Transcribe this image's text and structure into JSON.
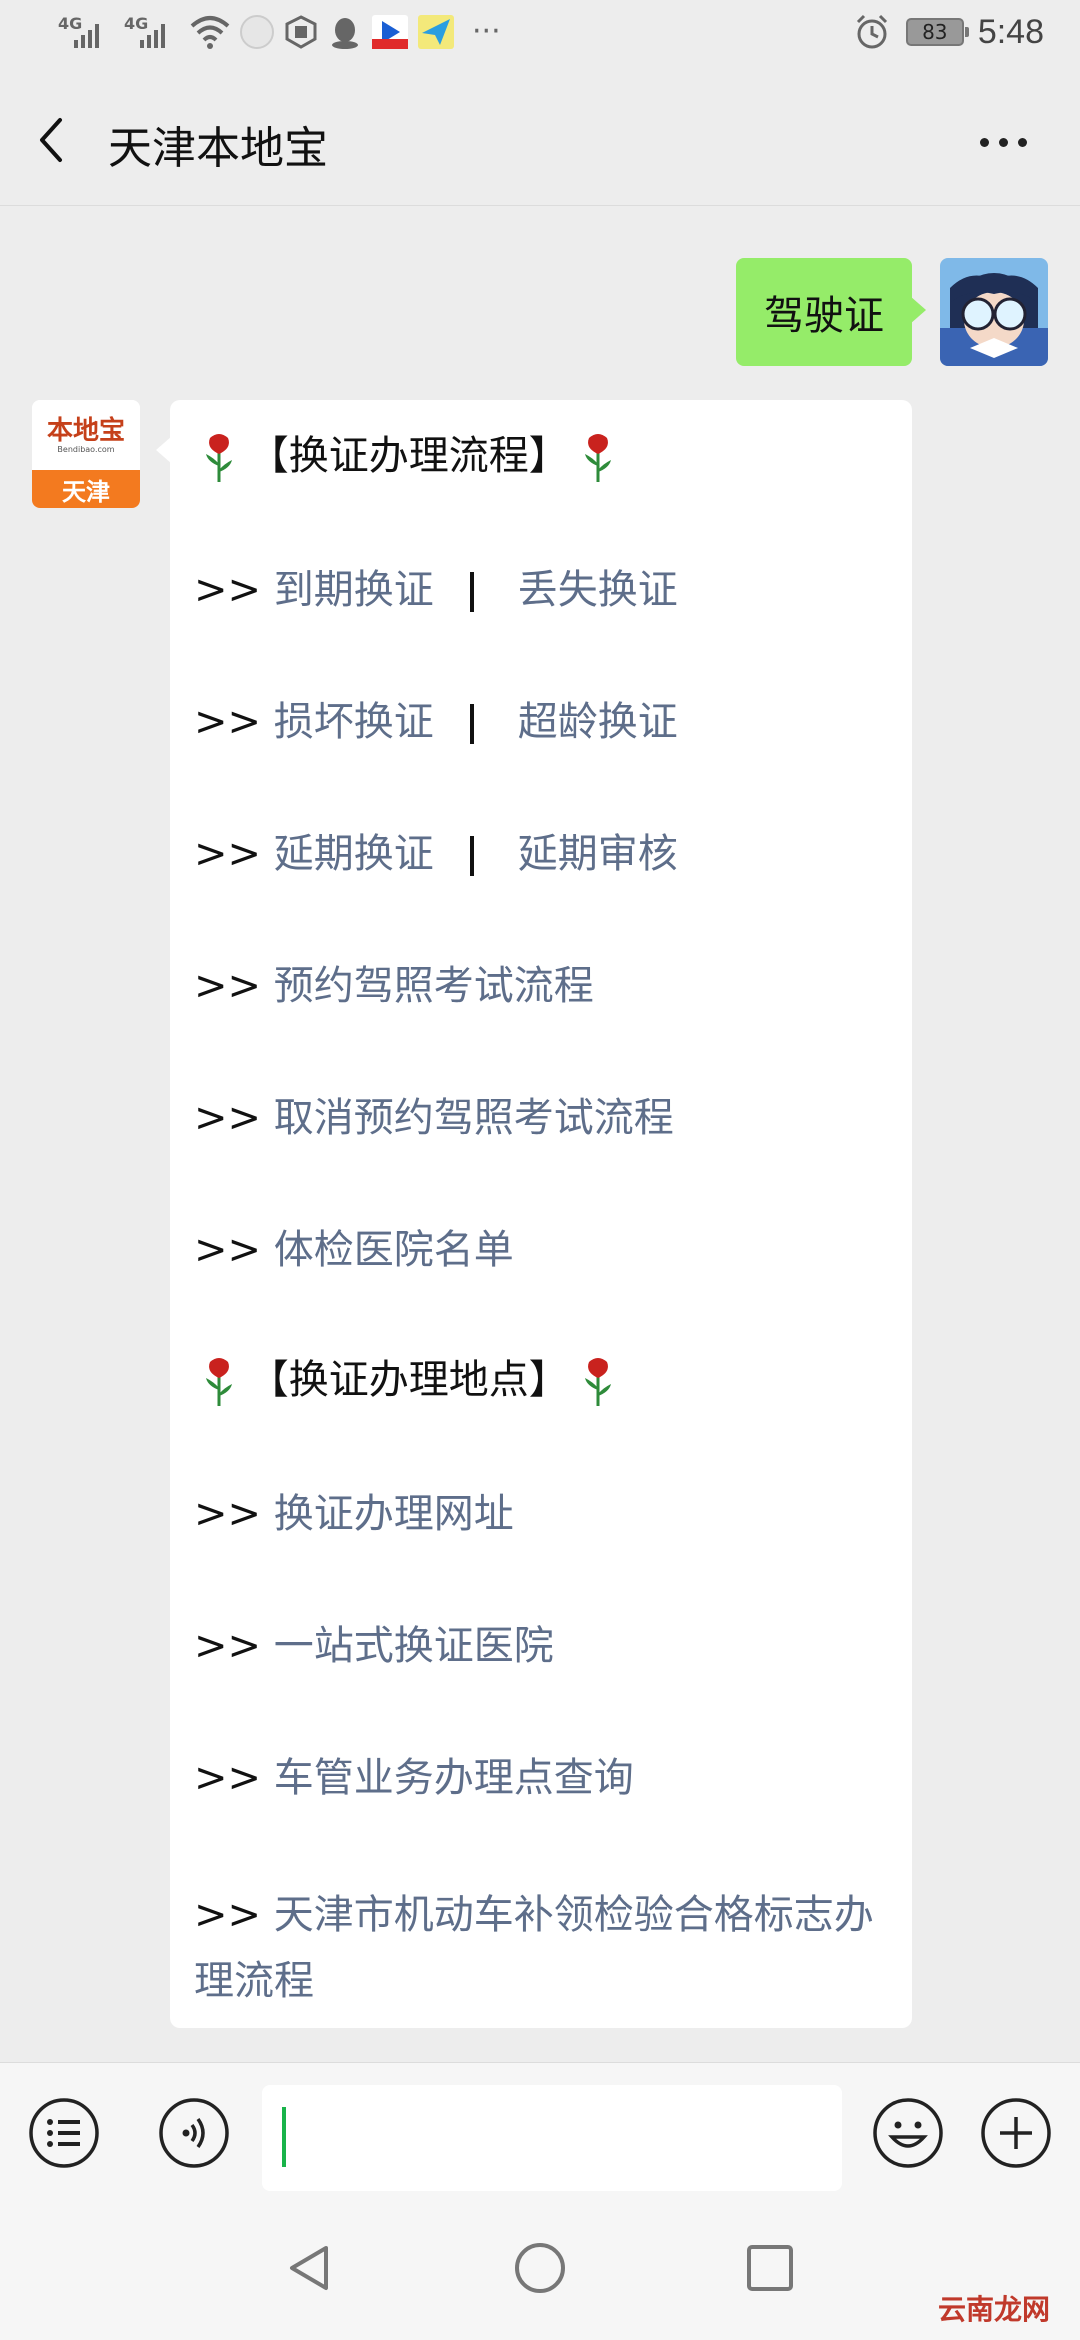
{
  "status_bar": {
    "network_1": "4G",
    "network_2": "4G",
    "battery": "83",
    "time": "5:48",
    "more": "···"
  },
  "nav": {
    "title": "天津本地宝"
  },
  "chat": {
    "user_message": "驾驶证",
    "bot_avatar": {
      "logo": "本地宝",
      "logo_sub": "Bendibao.com",
      "city": "天津"
    },
    "section_1": "【换证办理流程】",
    "section_2": "【换证办理地点】",
    "prefix": ">>",
    "links": {
      "expire": "到期换证",
      "lost": "丢失换证",
      "damaged": "损坏换证",
      "over_age": "超龄换证",
      "delay_renew": "延期换证",
      "delay_review": "延期审核",
      "book_exam": "预约驾照考试流程",
      "cancel_exam": "取消预约驾照考试流程",
      "hospital_list": "体检医院名单",
      "renew_site": "换证办理网址",
      "one_stop_hospital": "一站式换证医院",
      "vehicle_office": "车管业务办理点查询",
      "inspection_mark": "天津市机动车补领检验合格标志办理流程"
    }
  },
  "watermark": "云南龙网"
}
